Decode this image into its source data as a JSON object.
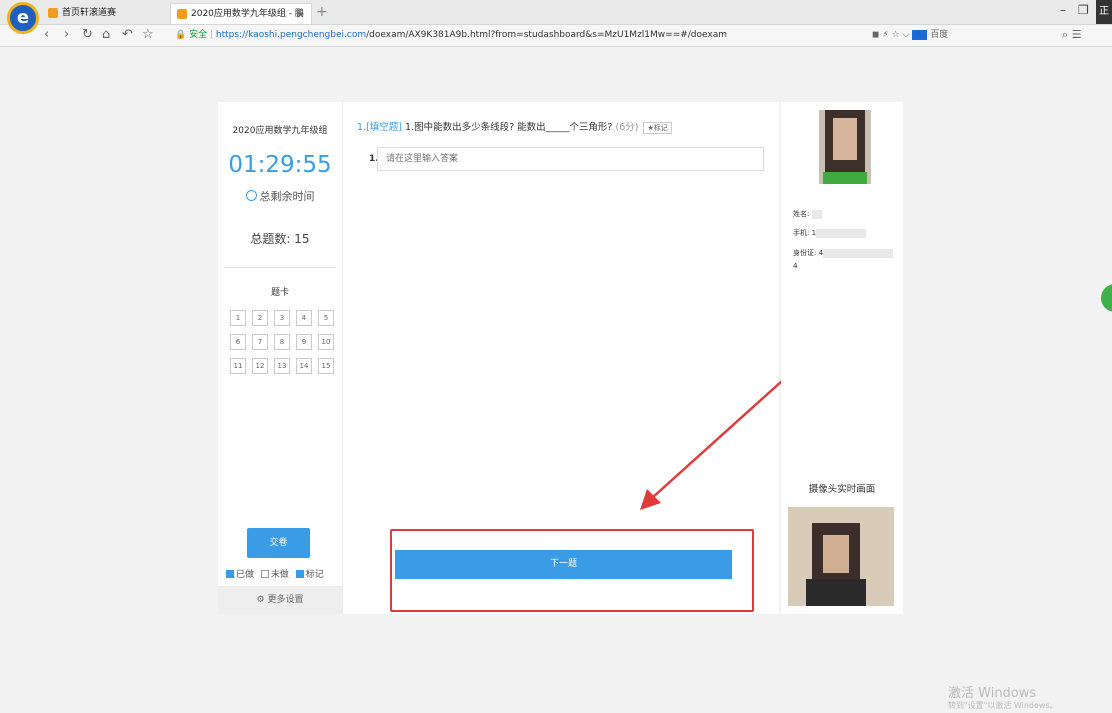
{
  "browser": {
    "logo_letter": "e",
    "tabs": [
      {
        "label": "首页轩滚道赛"
      },
      {
        "label": "2020应用数学九年级组 - 鹏"
      }
    ],
    "tab_close": "×",
    "new_tab": "+",
    "url_secure": "安全",
    "url_host": "https://kaoshi.pengchengbei.com",
    "url_path": "/doexam/AX9K381A9b.html?from=studashboard&s=MzU1Mzl1Mw==#/doexam",
    "search_engine": "百度",
    "lang_badge": "正"
  },
  "exam": {
    "name": "2020应用数学九年级组",
    "timer": "01:29:55",
    "timer_label": "总剩余时间",
    "total_label": "总题数: 15",
    "card_title": "题卡",
    "numbers": [
      "1",
      "2",
      "3",
      "4",
      "5",
      "6",
      "7",
      "8",
      "9",
      "10",
      "11",
      "12",
      "13",
      "14",
      "15"
    ],
    "submit_label": "交卷",
    "legend_done": "已做",
    "legend_todo": "未做",
    "legend_marked": "标记",
    "more_settings": "更多设置"
  },
  "question": {
    "index": "1.",
    "type": "[填空题]",
    "text": "1.图中能数出多少条线段? 能数出_____个三角形?",
    "score": "(6分)",
    "mark_label": "★标记",
    "answer_num": "1.",
    "answer_placeholder": "请在这里输入答案",
    "next_label": "下一题"
  },
  "candidate": {
    "name_label": "姓名:",
    "phone_label": "手机:",
    "phone_visible": "1",
    "id_label": "身份证:",
    "id_visible": "4",
    "id_line2": "4",
    "camera_label": "摄像头实时画面"
  },
  "os": {
    "activate_title": "激活 Windows",
    "activate_sub": "转到\"设置\"以激活 Windows。"
  },
  "colors": {
    "accent": "#3a9ce6",
    "highlight_border": "#e03a3a",
    "arrow": "#e03a3a"
  }
}
